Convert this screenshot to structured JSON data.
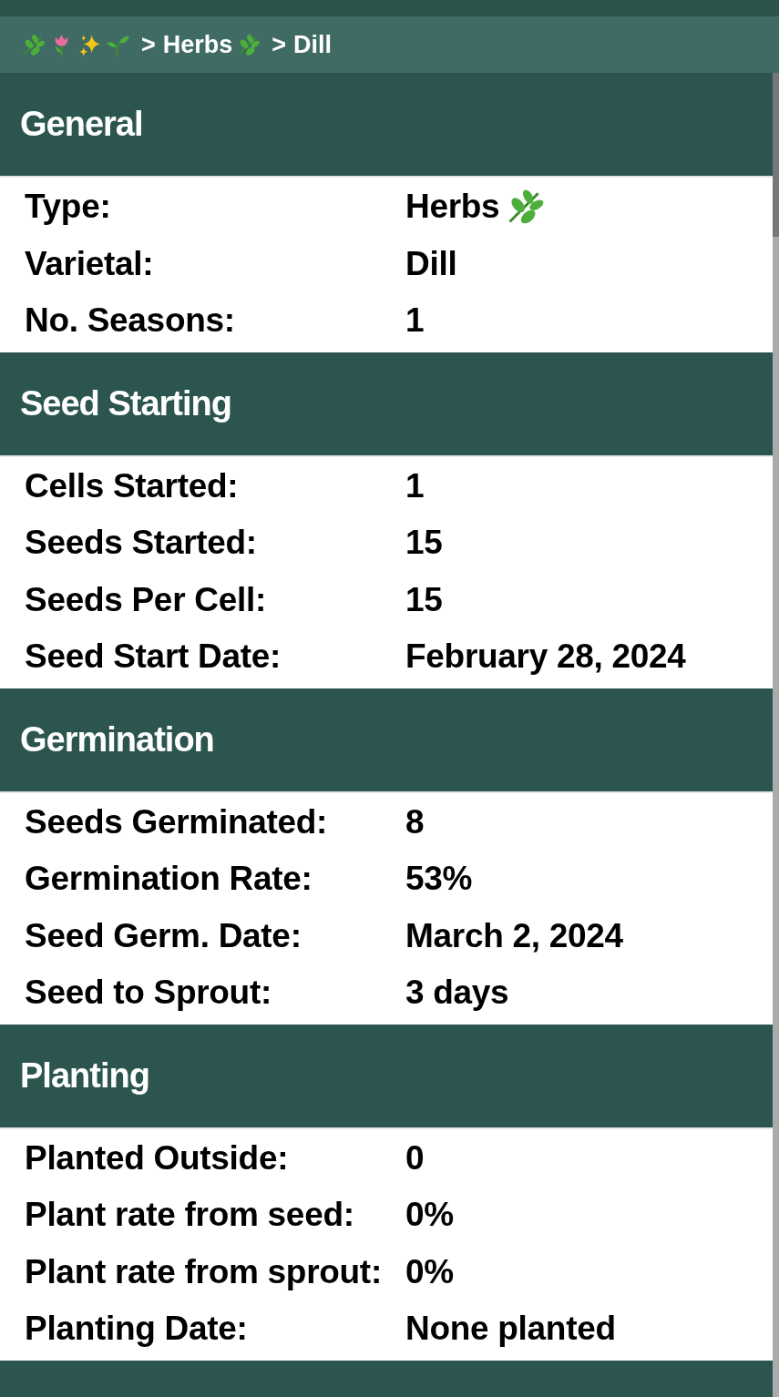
{
  "breadcrumb": {
    "separator": ">",
    "items": [
      {
        "label": "Herbs"
      },
      {
        "label": "Dill"
      }
    ]
  },
  "sections": [
    {
      "title": "General",
      "rows": [
        {
          "label": "Type:",
          "value": "Herbs",
          "herb_icon": true
        },
        {
          "label": "Varietal:",
          "value": "Dill"
        },
        {
          "label": "No. Seasons:",
          "value": "1"
        }
      ]
    },
    {
      "title": "Seed Starting",
      "rows": [
        {
          "label": "Cells Started:",
          "value": "1"
        },
        {
          "label": "Seeds Started:",
          "value": "15"
        },
        {
          "label": "Seeds Per Cell:",
          "value": "15"
        },
        {
          "label": "Seed Start Date:",
          "value": "February 28, 2024"
        }
      ]
    },
    {
      "title": "Germination",
      "rows": [
        {
          "label": "Seeds Germinated:",
          "value": "8"
        },
        {
          "label": "Germination Rate:",
          "value": "53%"
        },
        {
          "label": "Seed Germ. Date:",
          "value": "March 2, 2024"
        },
        {
          "label": "Seed to Sprout:",
          "value": "3 days"
        }
      ]
    },
    {
      "title": "Planting",
      "rows": [
        {
          "label": "Planted Outside:",
          "value": "0"
        },
        {
          "label": "Plant rate from seed:",
          "value": "0%"
        },
        {
          "label": "Plant rate from sprout:",
          "value": "0%"
        },
        {
          "label": "Planting Date:",
          "value": "None planted"
        }
      ]
    }
  ]
}
